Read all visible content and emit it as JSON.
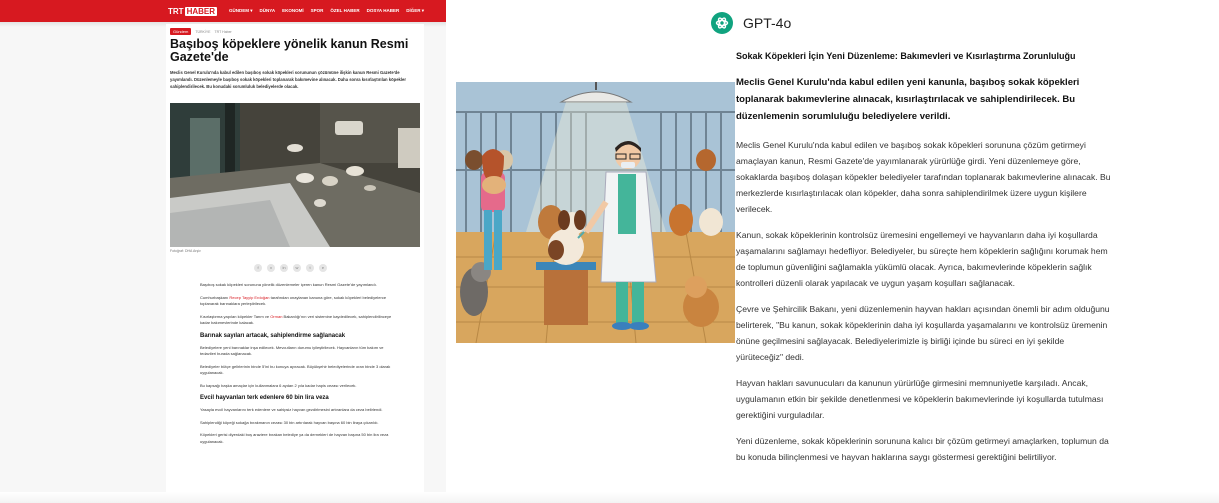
{
  "news": {
    "logo_part1": "TRT",
    "logo_part2": "HABER",
    "nav": [
      "GÜNDEM ▾",
      "DÜNYA",
      "EKONOMİ",
      "SPOR",
      "ÖZEL HABER",
      "DOSYA HABER",
      "DİĞER ▾"
    ],
    "badge": "Gündem",
    "meta": [
      "TÜRKİYE",
      "TRT Haber"
    ],
    "headline": "Başıboş köpeklere yönelik kanun Resmi Gazete'de",
    "lead": "Meclis Genel Kurulu'nda kabul edilen başıboş sokak köpekleri sorununun çözümüne ilişkin kanun Resmi Gazete'de yayımlandı. Düzenlemeyle başıboş sokak köpekleri toplanarak bakımevine alınacak. Daha sonra kısırlaştırılan köpekler sahiplendirilecek. Bu konudaki sorumluluk belediyelerde olacak.",
    "caption": "Fotoğraf: DHA Arşiv",
    "share": [
      "f",
      "x",
      "in",
      "w",
      "t",
      "e"
    ],
    "p1": "Başıboş sokak köpekleri sorununa yönelik düzenlemeler içeren kanun Resmi Gazete'de yayımlandı.",
    "p2a": "Cumhurbaşkanı ",
    "p2link": "Recep Tayyip Erdoğan",
    "p2b": " tarafından onaylanan kanuna göre, sokak köpekleri belediyelerce toplanarak barınaklara yerleştirilecek.",
    "p3a": "Kısırlaştırma yapılan köpekler Tarım ve ",
    "p3link": "Orman",
    "p3b": " Bakanlığı'nın veri sistemine kaydedilecek, sahiplendirilinceye kadar bakımevlerinde kalacak.",
    "h1": "Barınak sayıları artacak, sahiplendirme sağlanacak",
    "p4": "Belediyelere yeni barınaklar inşa edilecek. Mevcutların durumu iyileştirilecek. Hayvanların tüm bakım ve tedavileri burada sağlanacak.",
    "p5": "Belediyeler bütçe gelirlerinin binde 5'ini bu konuya ayıracak. Büyükşehir belediyelerinde oran binde 3 olarak uygulanacak.",
    "p6": "Bu kapsağı başka amaçlar için kullanmalara 6 aydan 2 yıla kadar hapis cezası verilecek.",
    "h2": "Evcil hayvanları terk edenlere 60 bin lira veza",
    "p7": "Yasayla evcil hayvanlarını terk edenlere ve sahipsiz hayvan gezdirlmesini artıranlara da ceza belirlendi.",
    "p8": "Sahiplendiği köpeği sokağa bırakmanın cezası 30 bin artırılarak hayvan başına 60 bin liraya çıkarıldı.",
    "p9": "Köpekleri gerisi diyerdaki boş araziere bırakan belediye ya da dernekleri de hayvan başına 50 bin lira veza uygulanacak."
  },
  "gpt": {
    "name": "GPT-4o",
    "title": "Sokak Köpekleri İçin Yeni Düzenleme: Bakımevleri ve Kısırlaştırma Zorunluluğu",
    "bold": "Meclis Genel Kurulu'nda kabul edilen yeni kanunla, başıboş sokak köpekleri toplanarak bakımevlerine alınacak, kısırlaştırılacak ve sahiplendirilecek. Bu düzenlemenin sorumluluğu belediyelere verildi.",
    "paragraphs": [
      "Meclis Genel Kurulu'nda kabul edilen ve başıboş sokak köpekleri sorununa çözüm getirmeyi amaçlayan kanun, Resmi Gazete'de yayımlanarak yürürlüğe girdi. Yeni düzenlemeye göre, sokaklarda başıboş dolaşan köpekler belediyeler tarafından toplanarak bakımevlerine alınacak. Bu merkezlerde kısırlaştırılacak olan köpekler, daha sonra sahiplendirilmek üzere uygun kişilere verilecek.",
      "Kanun, sokak köpeklerinin kontrolsüz üremesini engellemeyi ve hayvanların daha iyi koşullarda yaşamalarını sağlamayı hedefliyor. Belediyeler, bu süreçte hem köpeklerin sağlığını korumak hem de toplumun güvenliğini sağlamakla yükümlü olacak. Ayrıca, bakımevlerinde köpeklerin sağlık kontrolleri düzenli olarak yapılacak ve uygun yaşam koşulları sağlanacak.",
      "Çevre ve Şehircilik Bakanı, yeni düzenlemenin hayvan hakları açısından önemli bir adım olduğunu belirterek, \"Bu kanun, sokak köpeklerinin daha iyi koşullarda yaşamalarını ve kontrolsüz üremenin önüne geçilmesini sağlayacak. Belediyelerimizle iş birliği içinde bu süreci en iyi şekilde yürüteceğiz\" dedi.",
      "Hayvan hakları savunucuları da kanunun yürürlüğe girmesini memnuniyetle karşıladı. Ancak, uygulamanın etkin bir şekilde denetlenmesi ve köpeklerin bakımevlerinde iyi koşullarda tutulması gerektiğini vurguladılar.",
      "Yeni düzenleme, sokak köpeklerinin sorununa kalıcı bir çözüm getirmeyi amaçlarken, toplumun da bu konuda bilinçlenmesi ve hayvan haklarına saygı göstermesi gerektiğini belirtiliyor."
    ]
  },
  "colors": {
    "trt_red": "#d71920",
    "gpt_green": "#10a37f"
  }
}
